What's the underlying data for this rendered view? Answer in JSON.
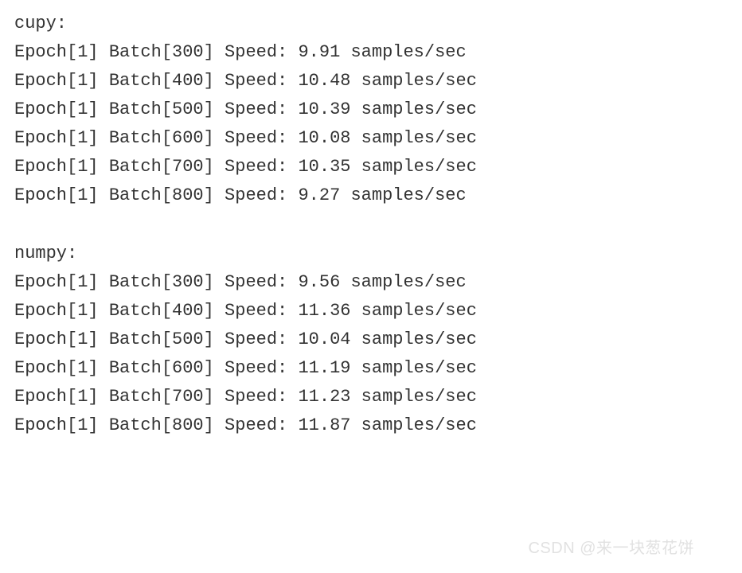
{
  "cupy": {
    "label": "cupy:",
    "lines": [
      "Epoch[1] Batch[300] Speed: 9.91 samples/sec",
      "Epoch[1] Batch[400] Speed: 10.48 samples/sec",
      "Epoch[1] Batch[500] Speed: 10.39 samples/sec",
      "Epoch[1] Batch[600] Speed: 10.08 samples/sec",
      "Epoch[1] Batch[700] Speed: 10.35 samples/sec",
      "Epoch[1] Batch[800] Speed: 9.27 samples/sec"
    ]
  },
  "numpy": {
    "label": "numpy:",
    "lines": [
      "Epoch[1] Batch[300] Speed: 9.56 samples/sec",
      "Epoch[1] Batch[400] Speed: 11.36 samples/sec",
      "Epoch[1] Batch[500] Speed: 10.04 samples/sec",
      "Epoch[1] Batch[600] Speed: 11.19 samples/sec",
      "Epoch[1] Batch[700] Speed: 11.23 samples/sec",
      "Epoch[1] Batch[800] Speed: 11.87 samples/sec"
    ]
  },
  "watermark": "CSDN @来一块葱花饼"
}
